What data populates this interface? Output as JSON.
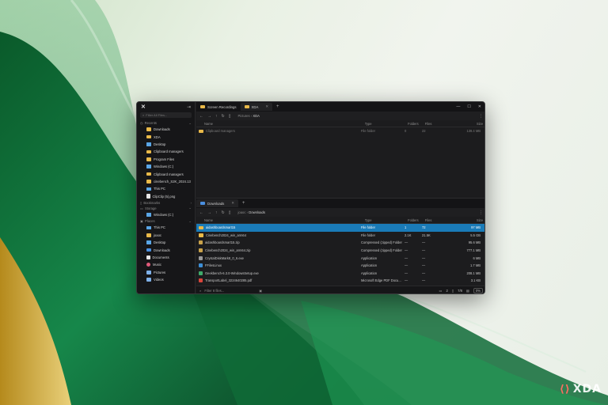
{
  "sidebar": {
    "filter_placeholder": "Filter All Files...",
    "recents_label": "Recents",
    "recents": [
      {
        "label": "Downloads",
        "icon": "folder-icon"
      },
      {
        "label": "XDA",
        "icon": "folder-icon"
      },
      {
        "label": "Desktop",
        "icon": "desktop-icon"
      },
      {
        "label": "Clipboard managers",
        "icon": "folder-icon"
      },
      {
        "label": "Program Files",
        "icon": "folder-icon"
      },
      {
        "label": "Windows (C:)",
        "icon": "drive-icon"
      },
      {
        "label": "Clipboard managers",
        "icon": "folder-icon"
      },
      {
        "label": "cinebench_S2K_2024.13",
        "icon": "folder-icon"
      },
      {
        "label": "This PC",
        "icon": "pc-icon"
      },
      {
        "label": "ClipClip (5).png",
        "icon": "file-icon"
      }
    ],
    "bookmarks_label": "Bookmarks",
    "storage_label": "Storage",
    "storage": [
      {
        "label": "Windows (C:)",
        "icon": "drive-icon"
      }
    ],
    "places_label": "Places",
    "places": [
      {
        "label": "This PC",
        "icon": "pc-icon"
      },
      {
        "label": "joaoc",
        "icon": "folder-icon"
      },
      {
        "label": "Desktop",
        "icon": "desktop-icon"
      },
      {
        "label": "Downloads",
        "icon": "downloads-icon"
      },
      {
        "label": "Documents",
        "icon": "documents-icon"
      },
      {
        "label": "Music",
        "icon": "music-icon"
      },
      {
        "label": "Pictures",
        "icon": "pictures-icon"
      },
      {
        "label": "Videos",
        "icon": "videos-icon"
      }
    ]
  },
  "top_pane": {
    "tabs": [
      {
        "label": "Screen Recordings"
      },
      {
        "label": "XDA"
      }
    ],
    "breadcrumb": [
      "Pictures",
      "XDA"
    ],
    "columns": {
      "name": "Name",
      "type": "Type",
      "folders": "Folders",
      "files": "Files",
      "size": "Size"
    },
    "rows": [
      {
        "name": "Clipboard managers",
        "type": "File folder",
        "folders": "0",
        "files": "22",
        "size": "139.4 MB"
      }
    ]
  },
  "bottom_pane": {
    "tabs": [
      {
        "label": "Downloads"
      }
    ],
    "breadcrumb": [
      "joaoc",
      "Downloads"
    ],
    "columns": {
      "name": "Name",
      "type": "Type",
      "folders": "Folders",
      "files": "Files",
      "size": "Size"
    },
    "rows": [
      {
        "name": "aidashboardsmart15",
        "type": "File folder",
        "folders": "1",
        "files": "72",
        "size": "97 MB",
        "icon": "folder-icon",
        "selected": true
      },
      {
        "name": "Cinebench2024_win_arm64",
        "type": "File folder",
        "folders": "2.1K",
        "files": "21.5K",
        "size": "5.5 GB",
        "icon": "folder-icon"
      },
      {
        "name": "aidashboardsmart15.zip",
        "type": "Compressed (zipped) Folder",
        "folders": "—",
        "files": "—",
        "size": "95.6 MB",
        "icon": "zip-icon"
      },
      {
        "name": "Cinebench2024_win_arm64.zip",
        "type": "Compressed (zipped) Folder",
        "folders": "—",
        "files": "—",
        "size": "777.1 MB",
        "icon": "zip-icon"
      },
      {
        "name": "CrystalDiskMark8_0_6.exe",
        "type": "Application",
        "folders": "—",
        "files": "—",
        "size": "6 MB",
        "icon": "app-icon"
      },
      {
        "name": "FFilesLinux",
        "type": "Application",
        "folders": "—",
        "files": "—",
        "size": "1.7 MB",
        "icon": "app-icon"
      },
      {
        "name": "Geekbench-6.3.0-WindowsSetup.exe",
        "type": "Application",
        "folders": "—",
        "files": "—",
        "size": "208.1 MB",
        "icon": "app-icon"
      },
      {
        "name": "TransportLabel_3224640285.pdf",
        "type": "Microsoft Edge PDF Docu...",
        "folders": "—",
        "files": "—",
        "size": "3.1 KB",
        "icon": "pdf-icon"
      }
    ],
    "filter_placeholder": "Filter 8 files...",
    "status": {
      "folders": "2",
      "files": "7/8",
      "zoom": "0%"
    }
  },
  "watermark": "XDA"
}
